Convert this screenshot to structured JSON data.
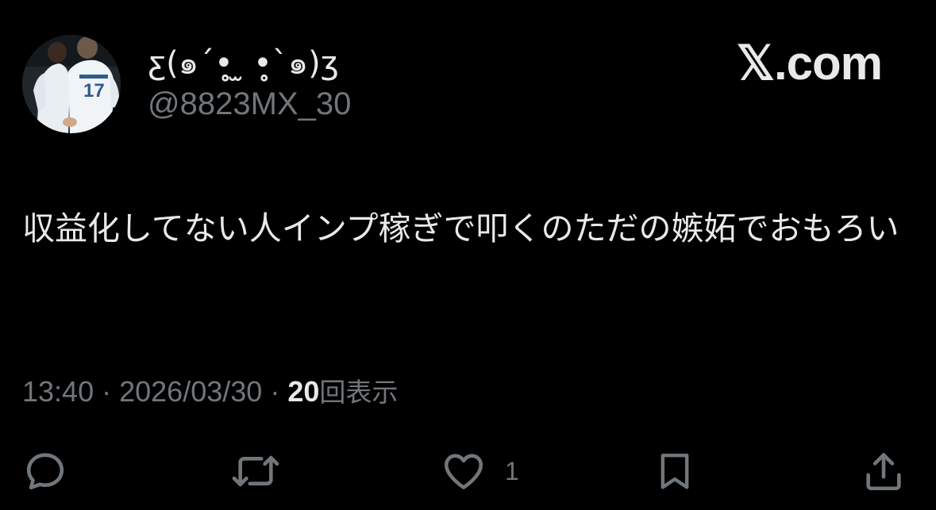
{
  "tweet": {
    "display_name": "ƹ(๑´•̥̥̥̥̥̥̥̥̥̥ ̫ •̥̥̥̥̥̥̥̥̥̥`๑)ʒ",
    "handle": "@8823MX_30",
    "brand": "𝕏.com",
    "text": "収益化してない人インプ稼ぎで叩くのただの嫉妬でおもろい",
    "time": "13:40",
    "separator": "·",
    "date": "2026/03/30",
    "view_count": "20",
    "views_label": "回表示",
    "like_count": "1"
  },
  "icons": {
    "avatar": "profile-photo",
    "reply": "reply-icon",
    "repost": "repost-icon",
    "like": "heart-icon",
    "bookmark": "bookmark-icon",
    "share": "share-icon"
  },
  "colors": {
    "background": "#000000",
    "primary_text": "#e7e9ea",
    "secondary_text": "#71767b"
  }
}
